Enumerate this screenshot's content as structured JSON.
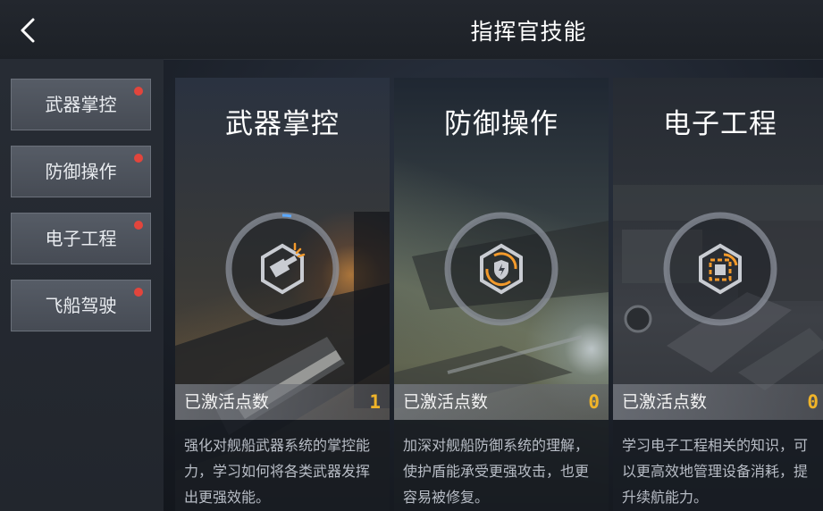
{
  "header": {
    "title": "指挥官技能",
    "back_icon": "chevron-left-icon"
  },
  "sidebar": {
    "items": [
      {
        "label": "武器掌控",
        "has_notification": true
      },
      {
        "label": "防御操作",
        "has_notification": true
      },
      {
        "label": "电子工程",
        "has_notification": true
      },
      {
        "label": "飞船驾驶",
        "has_notification": true
      }
    ]
  },
  "cards": [
    {
      "title": "武器掌控",
      "icon": "cannon-icon",
      "points_label": "已激活点数",
      "points_value": "1",
      "description": "强化对舰船武器系统的掌控能力，学习如何将各类武器发挥出更强效能。"
    },
    {
      "title": "防御操作",
      "icon": "shield-icon",
      "points_label": "已激活点数",
      "points_value": "0",
      "description": "加深对舰船防御系统的理解，使护盾能承受更强攻击，也更容易被修复。"
    },
    {
      "title": "电子工程",
      "icon": "chip-icon",
      "points_label": "已激活点数",
      "points_value": "0",
      "description": "学习电子工程相关的知识，可以更高效地管理设备消耗，提升续航能力。"
    }
  ],
  "colors": {
    "accent": "#f0b429",
    "notification": "#e2453c",
    "icon_orange": "#f39a2b"
  }
}
